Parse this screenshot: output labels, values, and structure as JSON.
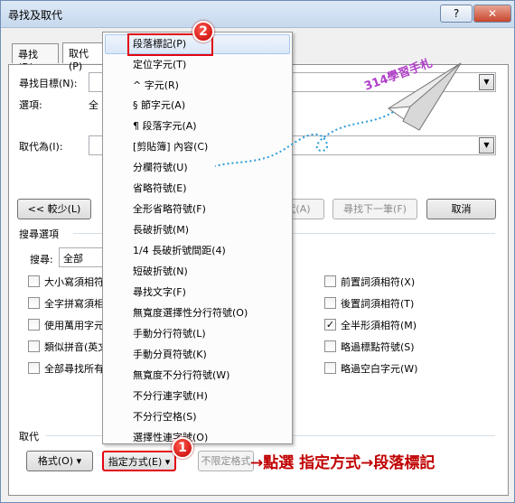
{
  "window": {
    "title": "尋找及取代",
    "help_button": "?",
    "close_button": "✕"
  },
  "tabs": [
    {
      "label": "尋找(D)"
    },
    {
      "label": "取代(P)"
    }
  ],
  "find": {
    "label": "尋找目標(N):",
    "value": "",
    "options_label": "選項:",
    "options_value": "全"
  },
  "replace": {
    "label": "取代為(I):",
    "value": ""
  },
  "buttons": {
    "less": "<< 較少(L)",
    "replace_all_partial": "代(A)",
    "find_next": "尋找下一筆(F)",
    "cancel": "取消"
  },
  "search_options": {
    "title": "搜尋選項",
    "search_label": "搜尋:",
    "search_value": "全部",
    "left_options": [
      {
        "label": "大小寫須相符",
        "checked": false
      },
      {
        "label": "全字拼寫須相",
        "checked": false
      },
      {
        "label": "使用萬用字元",
        "checked": false
      },
      {
        "label": "類似拼音(英文",
        "checked": false
      },
      {
        "label": "全部尋找所有",
        "checked": false
      }
    ],
    "right_options": [
      {
        "label": "前置詞須相符(X)",
        "checked": false
      },
      {
        "label": "後置詞須相符(T)",
        "checked": false
      },
      {
        "label": "全半形須相符(M)",
        "checked": true
      },
      {
        "label": "略過標點符號(S)",
        "checked": false
      },
      {
        "label": "略過空白字元(W)",
        "checked": false
      }
    ]
  },
  "replace_section": {
    "title": "取代",
    "format_button": "格式(O) ▾",
    "special_button": "指定方式(E) ▾",
    "no_format_button": "不限定格式"
  },
  "special_menu": {
    "items": [
      "段落標記(P)",
      "定位字元(T)",
      "^ 字元(R)",
      "§ 節字元(A)",
      "¶ 段落字元(A)",
      "[剪貼簿] 內容(C)",
      "分欄符號(U)",
      "省略符號(E)",
      "全形省略符號(F)",
      "長破折號(M)",
      "1/4 長破折號間距(4)",
      "短破折號(N)",
      "尋找文字(F)",
      "無寬度選擇性分行符號(O)",
      "手動分行符號(L)",
      "手動分頁符號(K)",
      "無寬度不分行符號(W)",
      "不分行連字號(H)",
      "不分行空格(S)",
      "選擇性連字號(O)"
    ]
  },
  "annotations": {
    "step1": "1",
    "step2": "2",
    "instruction": "→點選 指定方式→段落標記",
    "watermark": "314學習手札",
    "colors": {
      "red": "#c00000",
      "watermark": "#b040c8"
    }
  }
}
